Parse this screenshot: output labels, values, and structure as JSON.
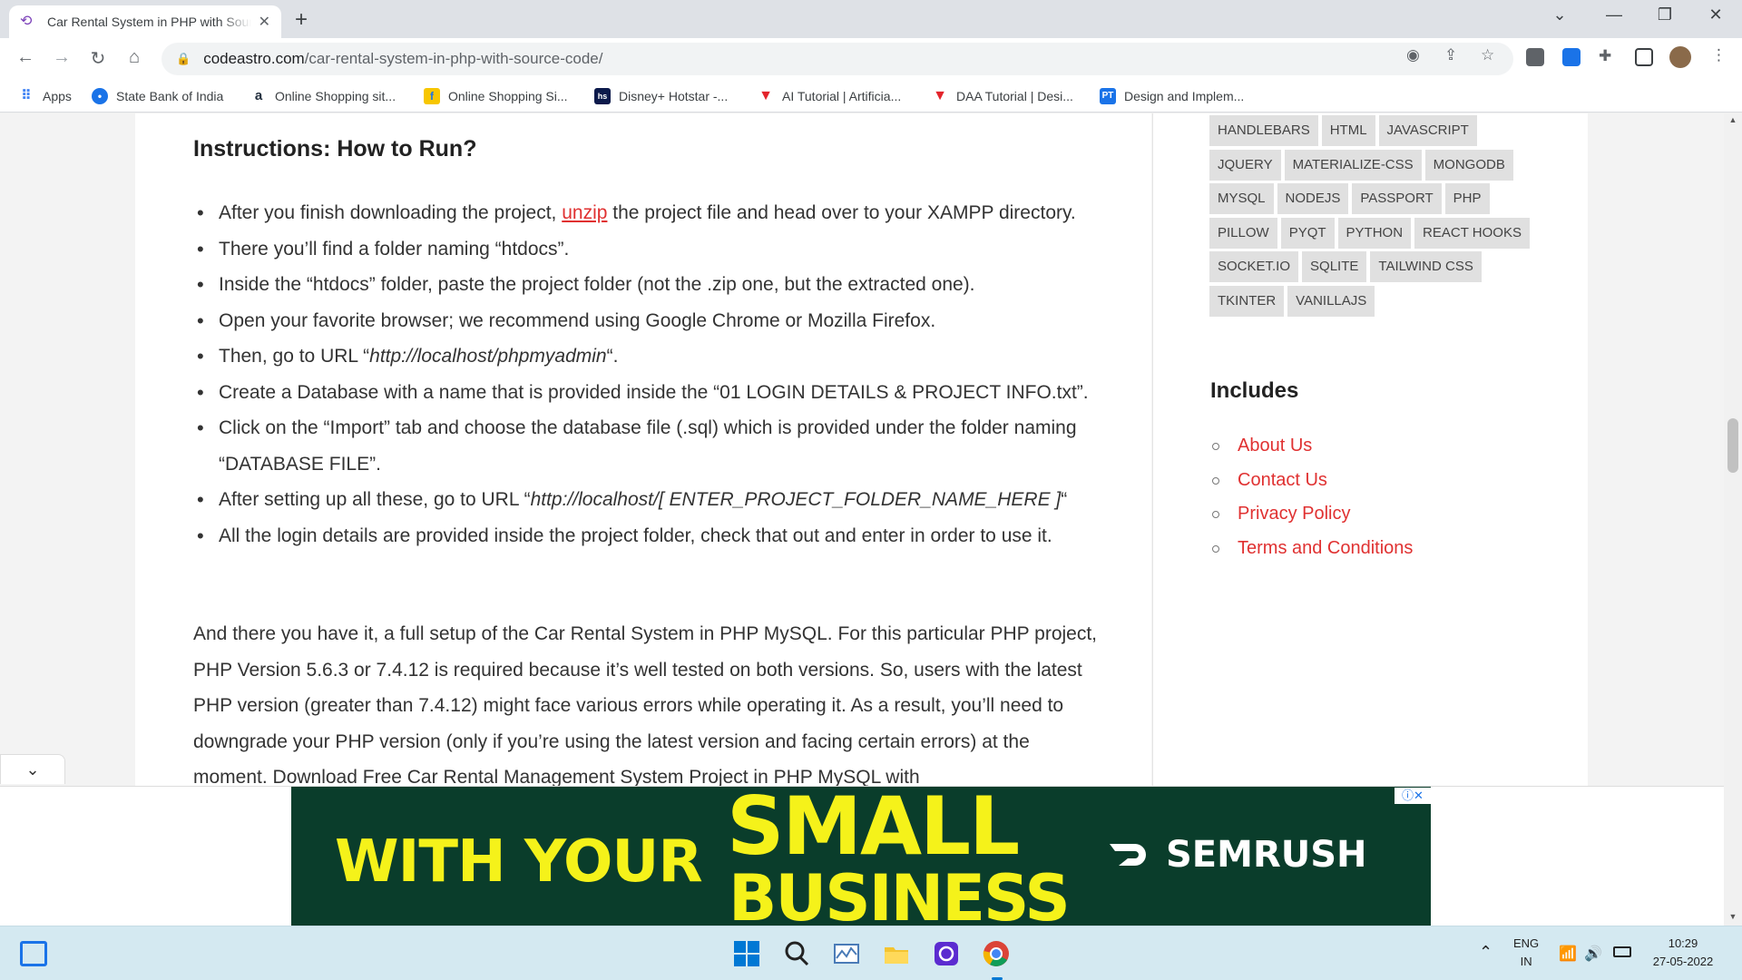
{
  "browser": {
    "tab_title": "Car Rental System in PHP with Source Code",
    "new_tab": "+",
    "url_domain": "codeastro.com",
    "url_path": "/car-rental-system-in-php-with-source-code/",
    "bookmarks": [
      {
        "label": "Apps",
        "icon": "apps-grid-icon",
        "color": "#4285f4"
      },
      {
        "label": "State Bank of India",
        "icon": "sbi-icon",
        "color": "#1a73e8"
      },
      {
        "label": "Online Shopping sit...",
        "icon": "amazon-icon",
        "color": "#232f3e"
      },
      {
        "label": "Online Shopping Si...",
        "icon": "flipkart-icon",
        "color": "#f7c600"
      },
      {
        "label": "Disney+ Hotstar -...",
        "icon": "hotstar-icon",
        "color": "#0c1a4b"
      },
      {
        "label": "AI Tutorial | Artificia...",
        "icon": "javatpoint-icon",
        "color": "#e3242b"
      },
      {
        "label": "DAA Tutorial | Desi...",
        "icon": "javatpoint-icon",
        "color": "#e3242b"
      },
      {
        "label": "Design and Implem...",
        "icon": "pt-icon",
        "color": "#1a73e8"
      }
    ]
  },
  "article": {
    "instructions_title": "Instructions: How to Run?",
    "steps": [
      {
        "pre": "After you finish downloading the project, ",
        "link": "unzip",
        "post": " the project file and head over to your XAMPP directory."
      },
      {
        "pre": "There you’ll find a folder naming “htdocs”."
      },
      {
        "pre": "Inside the “htdocs” folder, paste the project folder (not the .zip one, but the extracted one)."
      },
      {
        "pre": "Open your favorite browser; we recommend using Google Chrome or Mozilla Firefox."
      },
      {
        "pre": "Then, go to URL “",
        "em": "http://localhost/phpmyadmin",
        "post": "“."
      },
      {
        "pre": "Create a Database with a name that is provided inside the “01 LOGIN DETAILS & PROJECT INFO.txt”."
      },
      {
        "pre": "Click on the “Import” tab and choose the database file (.sql) which is provided under the folder naming “DATABASE FILE”."
      },
      {
        "pre": "After setting up all these, go to URL “",
        "em": "http://localhost/[ ENTER_PROJECT_FOLDER_NAME_HERE ]",
        "post": "“"
      },
      {
        "pre": "All the login details are provided inside the project folder, check that out and enter in order to use it."
      }
    ],
    "paragraph": "And there you have it, a full setup of the Car Rental System in PHP MySQL. For this particular PHP project, PHP Version 5.6.3 or 7.4.12 is required because it’s well tested on both versions. So, users with the latest PHP version (greater than 7.4.12) might face various errors while operating it. As a result, you’ll need to downgrade your PHP version (only if you’re using the latest version and facing certain errors) at the moment. Download Free Car Rental Management System Project in PHP MySQL with"
  },
  "sidebar": {
    "tags": [
      "HANDLEBARS",
      "HTML",
      "JAVASCRIPT",
      "JQUERY",
      "MATERIALIZE-CSS",
      "MONGODB",
      "MYSQL",
      "NODEJS",
      "PASSPORT",
      "PHP",
      "PILLOW",
      "PYQT",
      "PYTHON",
      "REACT HOOKS",
      "SOCKET.IO",
      "SQLITE",
      "TAILWIND CSS",
      "TKINTER",
      "VANILLAJS"
    ],
    "includes_title": "Includes",
    "includes": [
      "About Us",
      "Contact Us",
      "Privacy Policy",
      "Terms and Conditions"
    ]
  },
  "ad": {
    "line1": "WITH YOUR",
    "line2": "SMALL",
    "line3": "BUSINESS",
    "brand": "SEMRUSH",
    "choice": "ⓘ✕"
  },
  "taskbar": {
    "lang_top": "ENG",
    "lang_bottom": "IN",
    "time": "10:29",
    "date": "27-05-2022"
  },
  "colors": {
    "link": "#e03131",
    "ad_bg": "#0a3d2b",
    "ad_text": "#f5f21a"
  }
}
